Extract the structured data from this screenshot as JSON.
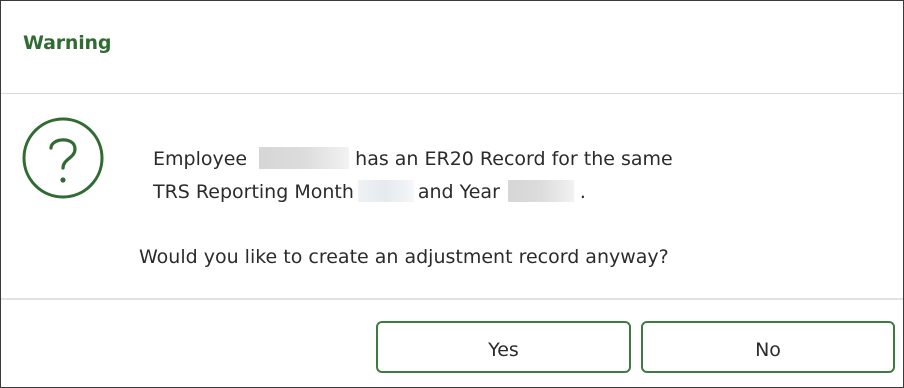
{
  "dialog": {
    "title": "Warning",
    "icon": "question-circle-icon",
    "accent_color": "#2f6b33",
    "message": {
      "line1_prefix": "Employee",
      "line1_suffix": "has an ER20 Record for the same",
      "line2_prefix": "TRS Reporting Month",
      "line2_middle": "and Year",
      "line2_suffix": "."
    },
    "prompt": "Would you like to create an adjustment record anyway?",
    "buttons": {
      "yes_label": "Yes",
      "no_label": "No"
    }
  }
}
